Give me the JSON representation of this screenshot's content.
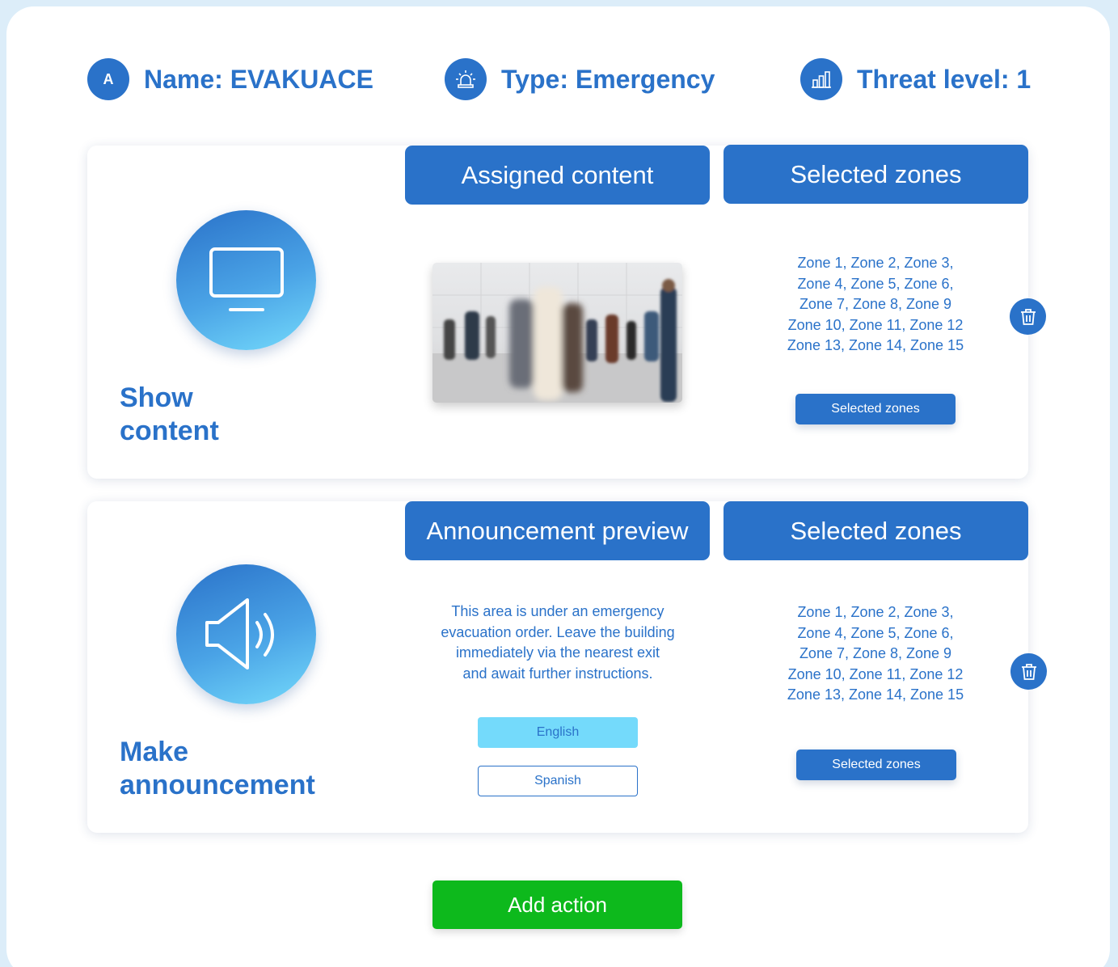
{
  "header": {
    "name": {
      "icon_letter": "A",
      "label": "Name: EVAKUACE"
    },
    "type": {
      "icon": "siren-icon",
      "label": "Type: Emergency"
    },
    "threat": {
      "icon": "chart-building-icon",
      "label": "Threat level: 1"
    }
  },
  "actions": [
    {
      "title_line1": "Show",
      "title_line2": "content",
      "icon": "monitor-icon",
      "content_header": "Assigned content",
      "zones_header": "Selected zones",
      "zones_lines": [
        "Zone 1, Zone 2, Zone 3,",
        "Zone 4, Zone 5, Zone 6,",
        "Zone 7, Zone 8, Zone 9",
        "Zone 10, Zone 11, Zone 12",
        "Zone 13, Zone 14, Zone 15"
      ],
      "zones_button": "Selected zones"
    },
    {
      "title_line1": "Make",
      "title_line2": "announcement",
      "icon": "speaker-icon",
      "content_header": "Announcement preview",
      "zones_header": "Selected zones",
      "announcement_lines": [
        "This area is under an emergency",
        "evacuation order. Leave the building",
        "immediately via the nearest exit",
        "and await further instructions."
      ],
      "languages": [
        {
          "label": "English",
          "selected": true
        },
        {
          "label": "Spanish",
          "selected": false
        }
      ],
      "zones_lines": [
        "Zone 1, Zone 2, Zone 3,",
        "Zone 4, Zone 5, Zone 6,",
        "Zone 7, Zone 8, Zone 9",
        "Zone 10, Zone 11, Zone 12",
        "Zone 13, Zone 14, Zone 15"
      ],
      "zones_button": "Selected zones"
    }
  ],
  "add_action_label": "Add action",
  "colors": {
    "primary": "#2a72c9",
    "accent_light": "#74dafb",
    "add_green": "#0db91c",
    "background": "#dcedf9"
  }
}
